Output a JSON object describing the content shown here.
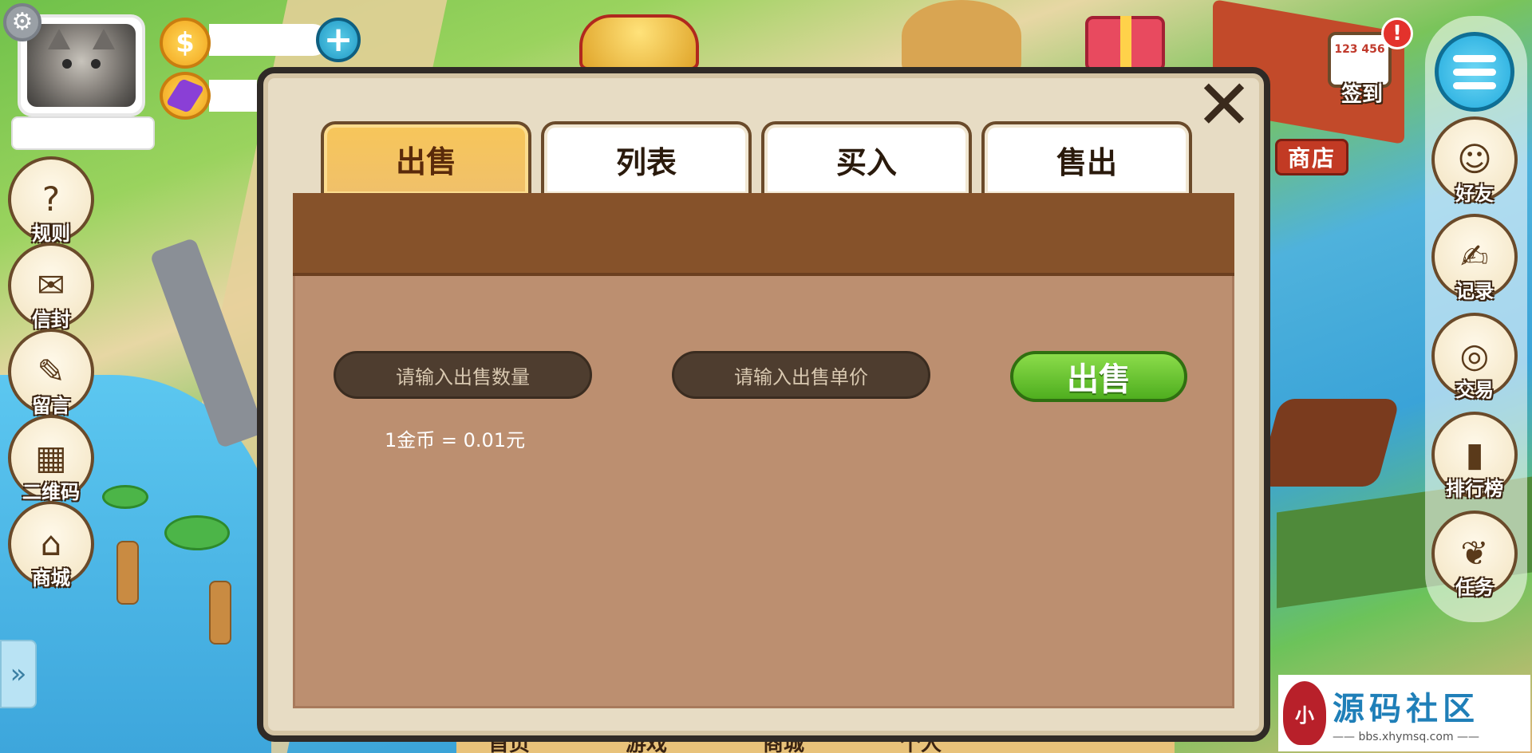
{
  "hud": {
    "settings_icon": "gear-icon",
    "coin_icon": "dollar-coin-icon",
    "coin_symbol": "$",
    "add_icon": "plus-icon",
    "add_symbol": "+",
    "gem_icon": "purple-gem-icon",
    "coin_value": "",
    "gem_value": "",
    "player_name": ""
  },
  "left_buttons": [
    {
      "label": "规则",
      "icon": "question-icon",
      "glyph": "?"
    },
    {
      "label": "信封",
      "icon": "envelope-icon",
      "glyph": "✉"
    },
    {
      "label": "留言",
      "icon": "quill-icon",
      "glyph": "✎"
    },
    {
      "label": "二维码",
      "icon": "qrcode-icon",
      "glyph": "▦"
    },
    {
      "label": "商城",
      "icon": "store-icon",
      "glyph": "⌂"
    }
  ],
  "right_buttons": [
    {
      "label": "好友",
      "icon": "friends-icon",
      "glyph": "☺"
    },
    {
      "label": "记录",
      "icon": "record-icon",
      "glyph": "✍"
    },
    {
      "label": "交易",
      "icon": "trade-coins-icon",
      "glyph": "◎"
    },
    {
      "label": "排行榜",
      "icon": "ranking-icon",
      "glyph": "▮"
    },
    {
      "label": "任务",
      "icon": "scroll-icon",
      "glyph": "❦"
    }
  ],
  "top_right": {
    "signin_label": "签到",
    "signin_calendar_text": "123\n456",
    "alert_badge": "!",
    "shop_sign": "商店",
    "menu_icon": "menu-icon"
  },
  "dialog": {
    "close_symbol": "✕",
    "tabs": [
      {
        "label": "出售",
        "active": true
      },
      {
        "label": "列表",
        "active": false
      },
      {
        "label": "买入",
        "active": false
      },
      {
        "label": "售出",
        "active": false
      }
    ],
    "quantity_placeholder": "请输入出售数量",
    "price_placeholder": "请输入出售单价",
    "sell_button": "出售",
    "rate_text": "1金币 = 0.01元"
  },
  "bottom_bar": [
    "首页",
    "游戏",
    "商城",
    "个人"
  ],
  "watermark": {
    "logo_text": "小",
    "title": "源码社区",
    "url": "—— bbs.xhymsq.com ——"
  },
  "expand_symbol": "»",
  "colors": {
    "dialog_frame": "#2f2a26",
    "panel_header": "#86522a",
    "panel_body": "#bc8f70",
    "active_tab": "#f7c65a",
    "sell_button": "#4fae1f",
    "input_pill": "#4e3d2f"
  }
}
